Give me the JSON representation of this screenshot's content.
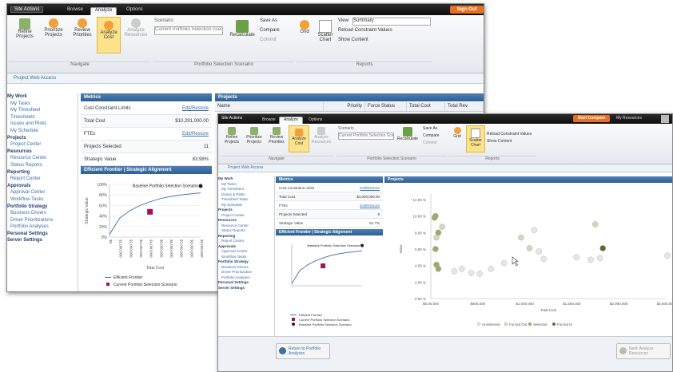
{
  "windowA": {
    "topbar": {
      "site_menu": "Site Actions",
      "tabs": [
        "Browse",
        "Analyze",
        "Options"
      ],
      "active_tab": "Analyze",
      "user_button": "Sign Out"
    },
    "ribbon": {
      "buttons": [
        {
          "label": "Refine Projects"
        },
        {
          "label": "Prioritize Projects"
        },
        {
          "label": "Review Priorities"
        },
        {
          "label": "Analyze Cost"
        },
        {
          "label": "Analyze Resources"
        }
      ],
      "scenario_label": "Scenario",
      "scenario_value": "Current Portfolio Selection Scenario",
      "recalculate": "Recalculate",
      "save_as": "Save As",
      "compare": "Compare",
      "commit": "Commit",
      "chart_labels": [
        "Grid",
        "Scatter Chart"
      ],
      "view_label": "View:",
      "view_value": "Summary",
      "options": [
        "Reload Constraint Values",
        "Show Content"
      ],
      "groups": [
        "Navigate",
        "Portfolio Selection Scenario",
        "Reports"
      ]
    },
    "breadcrumb": "Project Web Access",
    "sidebar": [
      {
        "text": "My Work",
        "heading": true
      },
      {
        "text": "My Tasks"
      },
      {
        "text": "My Timesheet"
      },
      {
        "text": "Timesheets"
      },
      {
        "text": "Issues and Risks"
      },
      {
        "text": "My Schedule"
      },
      {
        "text": "Projects",
        "heading": true
      },
      {
        "text": "Project Center"
      },
      {
        "text": "Resources",
        "heading": true
      },
      {
        "text": "Resource Center"
      },
      {
        "text": "Status Reports"
      },
      {
        "text": "Reporting",
        "heading": true
      },
      {
        "text": "Report Center"
      },
      {
        "text": "Approvals",
        "heading": true
      },
      {
        "text": "Approval Center"
      },
      {
        "text": "Workflow Tasks"
      },
      {
        "text": "Portfolio Strategy",
        "heading": true
      },
      {
        "text": "Business Drivers"
      },
      {
        "text": "Driver Prioritizations"
      },
      {
        "text": "Portfolio Analyses"
      },
      {
        "text": "Personal Settings",
        "heading": true
      },
      {
        "text": "Server Settings",
        "heading": true
      }
    ],
    "metrics": {
      "header": "Metrics",
      "rows": [
        {
          "label": "Cost Constraint Limits",
          "value": "Edit/Restore",
          "link": true
        },
        {
          "label": "Total Cost",
          "value": "$10,291,000.00",
          "link": false
        },
        {
          "label": "FTEs",
          "value": "Edit/Restore",
          "link": true
        },
        {
          "label": "Projects Selected",
          "value": "11",
          "link": false
        },
        {
          "label": "Strategic Value",
          "value": "83.98%",
          "link": false
        }
      ],
      "frontier_header": "Efficient Frontier | Strategic Alignment"
    },
    "projects": {
      "header": "Projects",
      "columns": [
        "Name",
        "Priority",
        "Force Status",
        "Total Cost",
        "Total Rev"
      ]
    },
    "chart": {
      "y_ticks": [
        "100%",
        "80%",
        "60%",
        "40%",
        "20%",
        "0%"
      ],
      "y_label": "Strategic Value",
      "x_label": "Total Cost",
      "x_ticks": [
        "$0",
        "$1,000,000",
        "$2,000,000",
        "$3,000,000",
        "$4,000,000",
        "$5,000,000",
        "$6,000,000",
        "$7,000,000",
        "$8,000,000",
        "$9,000,000"
      ],
      "marker_label": "Baseline Portfolio Selection Scenario",
      "legend": [
        "Efficient Frontier",
        "Current Portfolio Selection Scenario"
      ]
    }
  },
  "windowB": {
    "topbar": {
      "site_menu": "Site Actions",
      "tabs": [
        "Browse",
        "Analyze",
        "Options"
      ],
      "active_tab": "Analyze",
      "user_button": "Start Compare",
      "user_name": "My Resources"
    },
    "ribbon": {
      "buttons": [
        {
          "label": "Refine Projects"
        },
        {
          "label": "Prioritize Projects"
        },
        {
          "label": "Review Priorities"
        },
        {
          "label": "Analyze Cost"
        },
        {
          "label": "Analyze Resources"
        }
      ],
      "scenario_label": "Scenario",
      "scenario_value": "Current Portfolio Selection Scenario",
      "recalculate": "Recalculate",
      "actions": [
        "Save As",
        "Compare",
        "Commit"
      ],
      "grid_label": "Grid",
      "scatter_label": "Scatter Chart",
      "options": [
        "Reload Constraint Values",
        "Show Content"
      ],
      "groups": [
        "Navigate",
        "Portfolio Selection Scenario",
        "Reports"
      ]
    },
    "breadcrumb": "Project Web Access",
    "sidebar": [
      {
        "text": "My Work",
        "heading": true
      },
      {
        "text": "My Tasks"
      },
      {
        "text": "My Timesheet"
      },
      {
        "text": "Issues & Risks"
      },
      {
        "text": "Timesheet Tasks"
      },
      {
        "text": "My Schedule"
      },
      {
        "text": "Projects",
        "heading": true
      },
      {
        "text": "Project Center"
      },
      {
        "text": "Resources",
        "heading": true
      },
      {
        "text": "Resource Center"
      },
      {
        "text": "Status Reports"
      },
      {
        "text": "Reporting",
        "heading": true
      },
      {
        "text": "Report Center"
      },
      {
        "text": "Approvals",
        "heading": true
      },
      {
        "text": "Approval Center"
      },
      {
        "text": "Workflow Tasks"
      },
      {
        "text": "Portfolio Strategy",
        "heading": true
      },
      {
        "text": "Business Drivers"
      },
      {
        "text": "Driver Prioritization"
      },
      {
        "text": "Portfolio Analyses"
      },
      {
        "text": "Personal Settings",
        "heading": true
      },
      {
        "text": "Server Settings",
        "heading": true
      }
    ],
    "metrics": {
      "header": "Metrics",
      "rows": [
        {
          "label": "Cost Constraint Limits",
          "value": "Edit/Restore",
          "link": true
        },
        {
          "label": "Total Cost",
          "value": "$4,000,000.00",
          "link": false
        },
        {
          "label": "FTEs",
          "value": "Edit/Restore",
          "link": true
        },
        {
          "label": "Projects Selected",
          "value": "8",
          "link": false
        },
        {
          "label": "Strategic Value",
          "value": "61.7%",
          "link": false
        }
      ],
      "frontier_header": "Efficient Frontier | Strategic Alignment",
      "marker_label": "Baseline Portfolio Selection Scenario",
      "legend": [
        "Efficient Frontier",
        "Current Portfolio Selection Scenario",
        "Baseline Portfolio Selection Scenario"
      ]
    },
    "projects": {
      "header": "Projects"
    },
    "footer": {
      "left": "Return to Portfolio Analyses",
      "right": "Next: Analyze Resources"
    },
    "scatter_legend": [
      "Unselected",
      "Forced Out",
      "Selected",
      "Forced In"
    ]
  },
  "chart_data": [
    {
      "type": "line",
      "title": "Efficient Frontier | Strategic Alignment",
      "xlabel": "Total Cost",
      "ylabel": "Strategic Value",
      "x": [
        0,
        1000000,
        2000000,
        3000000,
        4000000,
        5000000,
        6000000,
        7000000,
        8000000,
        9000000
      ],
      "series": [
        {
          "name": "Efficient Frontier",
          "values": [
            0.05,
            0.36,
            0.5,
            0.6,
            0.67,
            0.73,
            0.77,
            0.8,
            0.82,
            0.84
          ]
        }
      ],
      "points": [
        {
          "name": "Current Portfolio Selection Scenario",
          "x": 4000000,
          "y": 0.48
        },
        {
          "name": "Baseline Portfolio Selection Scenario",
          "x": 9000000,
          "y": 0.97
        }
      ],
      "ylim": [
        0,
        1
      ]
    },
    {
      "type": "scatter",
      "xlabel": "Total Cost",
      "ylabel": "Value",
      "x_ticks": [
        "$0.00.000",
        "$500,000",
        "$1,000,000",
        "$1,500,000",
        "$2,000,000",
        "$2,500,000"
      ],
      "y_ticks": [
        "0.00 %",
        "2.00 %",
        "4.00 %",
        "6.00 %",
        "8.00 %",
        "10.00 %",
        "12.00 %"
      ],
      "xlim": [
        0,
        2500000
      ],
      "ylim": [
        0,
        12
      ],
      "series": [
        {
          "name": "Unselected",
          "color": "#e6e6e6",
          "points": [
            [
              1100000,
              8.3
            ],
            [
              1150000,
              5.7
            ],
            [
              1550000,
              5.0
            ],
            [
              780000,
              4.3
            ],
            [
              1200000,
              4.8
            ],
            [
              330000,
              3.6
            ],
            [
              520000,
              3.0
            ],
            [
              640000,
              3.6
            ],
            [
              2580000,
              5.2
            ],
            [
              1700000,
              4.7
            ],
            [
              250000,
              3.3
            ],
            [
              430000,
              3.1
            ],
            [
              1800000,
              4.9
            ]
          ]
        },
        {
          "name": "Forced Out",
          "color": "#cfd9b8",
          "points": [
            [
              960000,
              7.4
            ],
            [
              1050000,
              6.1
            ],
            [
              1750000,
              9.0
            ],
            [
              60000,
              7.4
            ],
            [
              120000,
              8.7
            ]
          ]
        },
        {
          "name": "Selected",
          "color": "#9aab6c",
          "points": [
            [
              50000,
              10.0
            ],
            [
              60000,
              4.1
            ],
            [
              80000,
              3.6
            ],
            [
              50000,
              6.0
            ],
            [
              80000,
              8.0
            ],
            [
              40000,
              9.8
            ]
          ]
        },
        {
          "name": "Forced In",
          "color": "#5c6b2e",
          "points": [
            [
              1830000,
              6.1
            ]
          ]
        }
      ]
    }
  ]
}
